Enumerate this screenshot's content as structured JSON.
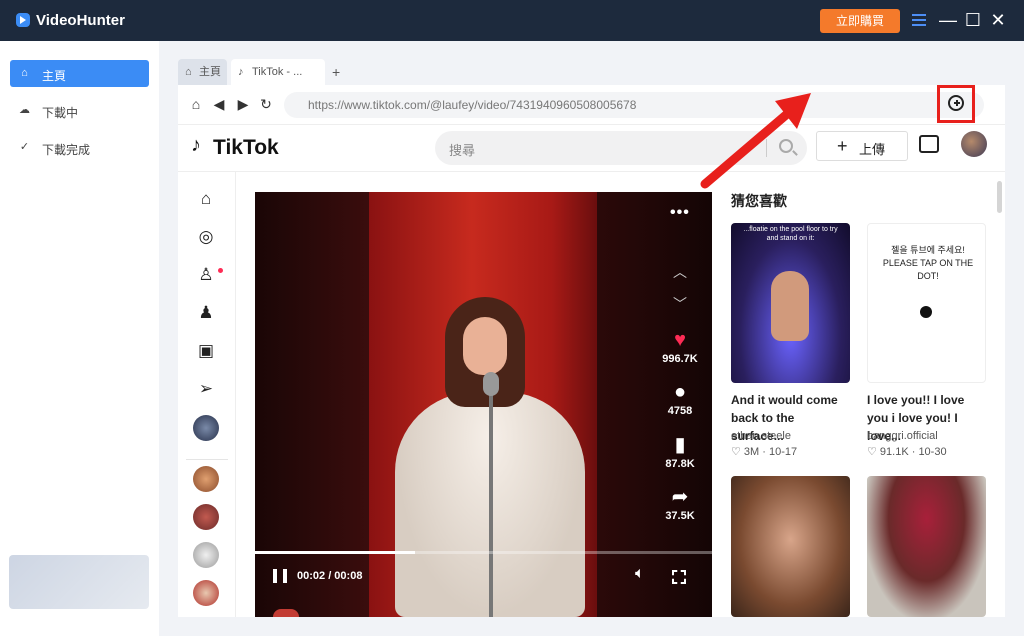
{
  "app": {
    "title": "VideoHunter",
    "buy_label": "立即購買",
    "accent_color": "#3b8cf5",
    "buy_color": "#f47a2b"
  },
  "sidebar": {
    "items": [
      {
        "label": "主頁",
        "icon": "home-icon",
        "active": true
      },
      {
        "label": "下載中",
        "icon": "cloud-download-icon",
        "active": false
      },
      {
        "label": "下載完成",
        "icon": "check-circle-icon",
        "active": false
      }
    ]
  },
  "tabs": {
    "home_label": "主頁",
    "tiktok_label": "TikTok - ...",
    "new_tab": "+"
  },
  "browser": {
    "url": "https://www.tiktok.com/@laufey/video/7431940960508005678",
    "highlight_color": "#e8201c"
  },
  "tiktok": {
    "logo": "TikTok",
    "search_placeholder": "搜尋",
    "upload_label": "上傳",
    "video": {
      "likes": "996.7K",
      "comments": "4758",
      "saves": "87.8K",
      "shares": "37.5K",
      "time": "00:02 / 00:08",
      "progress": 0.35
    },
    "recommend_title": "猜您喜歡",
    "recommendations": [
      {
        "desc": "And it would come back to the surface...",
        "user": "ethan.steele",
        "stats": "♡ 3M · 10-17",
        "thumb_text": "...floatie on the pool floor to try and stand on it:"
      },
      {
        "desc": "I love you!! I love you i love you! I love...",
        "user": "banggri.official",
        "stats": "♡ 91.1K · 10-30",
        "thumb_text": "젤을 튜브에 주세요! PLEASE TAP ON THE DOT!"
      },
      {
        "desc": "",
        "user": "",
        "stats": ""
      },
      {
        "desc": "",
        "user": "",
        "stats": ""
      }
    ]
  }
}
